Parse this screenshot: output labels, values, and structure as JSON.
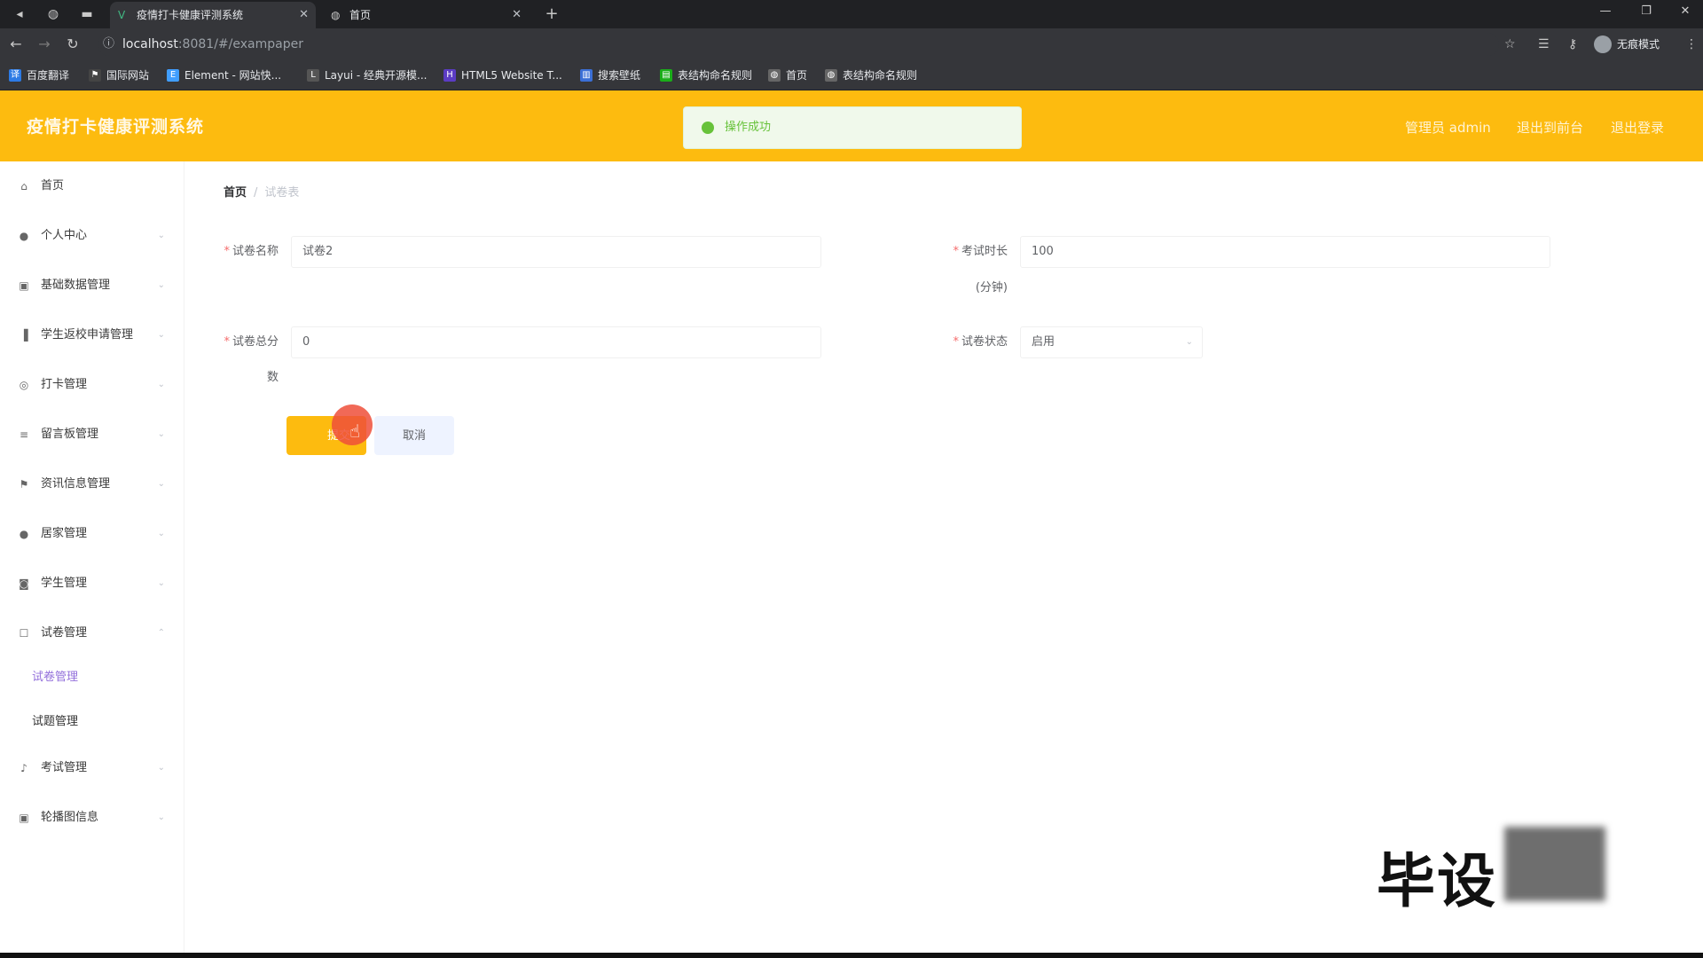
{
  "browser": {
    "tabs": [
      {
        "title": "疫情打卡健康评测系统",
        "icon": "vue-icon",
        "active": true
      },
      {
        "title": "首页",
        "icon": "globe-icon",
        "active": false
      }
    ],
    "new_tab": "+",
    "url_host": "localhost",
    "url_path": ":8081/#/exampaper",
    "profile_label": "无痕模式",
    "bookmarks": [
      {
        "label": "百度翻译",
        "icon": "translate-icon",
        "color": "#2d7be5"
      },
      {
        "label": "国际网站",
        "icon": "flag-icon",
        "color": "#444444"
      },
      {
        "label": "Element - 网站快...",
        "icon": "element-icon",
        "color": "#409eff"
      },
      {
        "label": "Layui - 经典开源模...",
        "icon": "layui-icon",
        "color": "#555555"
      },
      {
        "label": "HTML5 Website T...",
        "icon": "html5-icon",
        "color": "#5b3cc4"
      },
      {
        "label": "搜索壁纸",
        "icon": "chart-icon",
        "color": "#3b6fd6"
      },
      {
        "label": "表结构命名规则",
        "icon": "doc-icon",
        "color": "#1aad19"
      },
      {
        "label": "首页",
        "icon": "globe-icon",
        "color": "#666666"
      },
      {
        "label": "表结构命名规则",
        "icon": "globe-icon",
        "color": "#666666"
      }
    ]
  },
  "header": {
    "title": "疫情打卡健康评测系统",
    "toast": "操作成功",
    "links": [
      "管理员 admin",
      "退出到前台",
      "退出登录"
    ],
    "accent": "#fdbb0f"
  },
  "sidebar": {
    "items": [
      {
        "label": "首页",
        "icon": "home-icon",
        "has_arrow": false
      },
      {
        "label": "个人中心",
        "icon": "user-icon",
        "has_arrow": true
      },
      {
        "label": "基础数据管理",
        "icon": "image-icon",
        "has_arrow": true
      },
      {
        "label": "学生返校申请管理",
        "icon": "bar-chart-icon",
        "has_arrow": true
      },
      {
        "label": "打卡管理",
        "icon": "compass-icon",
        "has_arrow": true
      },
      {
        "label": "留言板管理",
        "icon": "list-icon",
        "has_arrow": true
      },
      {
        "label": "资讯信息管理",
        "icon": "flag-icon",
        "has_arrow": true
      },
      {
        "label": "居家管理",
        "icon": "user-icon",
        "has_arrow": true
      },
      {
        "label": "学生管理",
        "icon": "camera-icon",
        "has_arrow": true
      },
      {
        "label": "试卷管理",
        "icon": "checkbox-icon",
        "has_arrow": true
      }
    ],
    "sub_items": [
      {
        "label": "试卷管理",
        "active": true
      },
      {
        "label": "试题管理",
        "active": false
      }
    ],
    "items_after": [
      {
        "label": "考试管理",
        "icon": "mic-icon",
        "has_arrow": true
      },
      {
        "label": "轮播图信息",
        "icon": "image-icon",
        "has_arrow": true
      }
    ]
  },
  "breadcrumb": {
    "home": "首页",
    "separator": "/",
    "current": "试卷表"
  },
  "form": {
    "paper_name_label": "试卷名称",
    "paper_name_value": "试卷2",
    "duration_label": "考试时长",
    "duration_unit": "(分钟)",
    "duration_value": "100",
    "total_label": "试卷总分",
    "total_label_tail": "数",
    "total_value": "0",
    "status_label": "试卷状态",
    "status_value": "启用",
    "submit_label": "提交",
    "cancel_label": "取消"
  },
  "watermark": "毕设"
}
